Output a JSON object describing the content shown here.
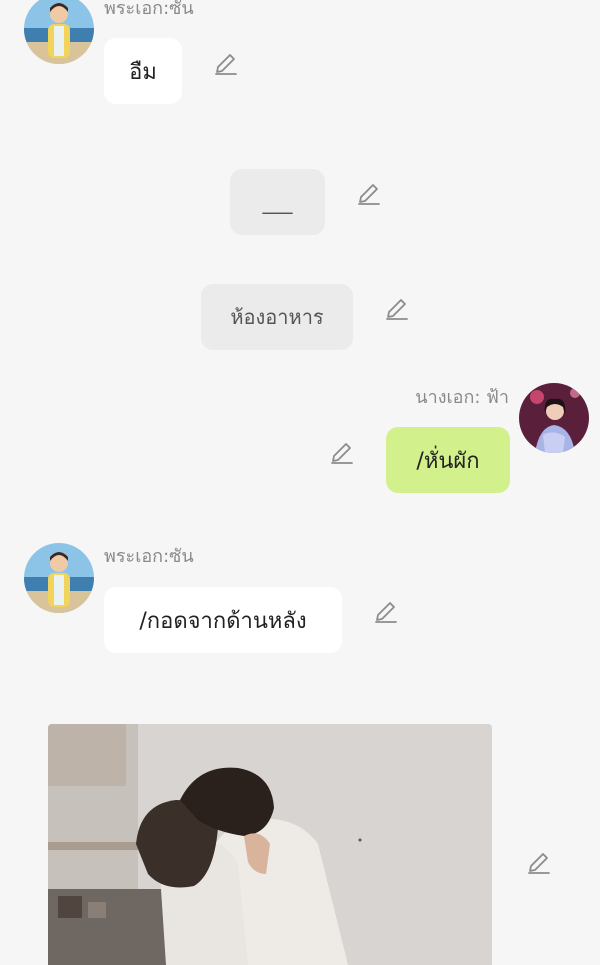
{
  "messages": [
    {
      "sender": "พระเอก:ซัน",
      "text": "อืม"
    },
    {
      "system_text": "___"
    },
    {
      "system_text": "ห้องอาหาร"
    },
    {
      "sender": "นางเอก: ฟ้า",
      "text": "/หั่นผัก"
    },
    {
      "sender": "พระเอก:ซัน",
      "text": "/กอดจากด้านหลัง"
    }
  ],
  "icons": {
    "edit": "edit-pencil-icon",
    "avatar_male": "avatar-male-beach",
    "avatar_female": "avatar-female-pink"
  },
  "colors": {
    "background": "#f6f6f6",
    "bubble_white": "#ffffff",
    "bubble_green": "#d2f08c",
    "bubble_system": "#ebebeb",
    "name_text": "#8a8a8a"
  }
}
